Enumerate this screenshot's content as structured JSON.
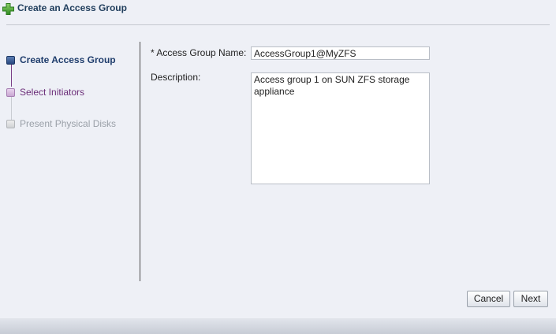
{
  "window": {
    "title": "Create an Access Group",
    "icon": "add-icon",
    "accent_color": "#3a9a2b"
  },
  "train": {
    "steps": [
      {
        "label": "Create Access Group",
        "state": "active"
      },
      {
        "label": "Select Initiators",
        "state": "next"
      },
      {
        "label": "Present Physical Disks",
        "state": "disabled"
      }
    ]
  },
  "form": {
    "name_label": "* Access Group Name:",
    "name_value": "AccessGroup1@MyZFS",
    "description_label": "Description:",
    "description_value": "Access group 1 on SUN ZFS storage appliance"
  },
  "buttons": {
    "cancel": "Cancel",
    "next": "Next"
  }
}
